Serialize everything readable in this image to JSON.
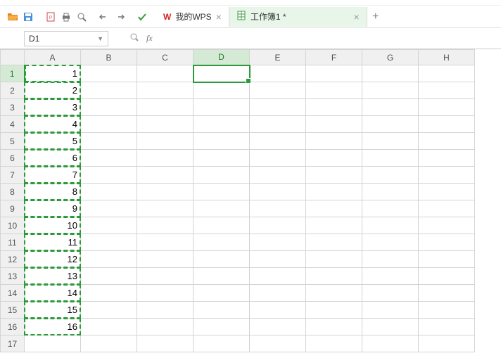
{
  "toolbar": {
    "open_icon": "folder-open-icon",
    "save_icon": "save-icon",
    "export_icon": "export-icon",
    "print_icon": "print-icon",
    "preview_icon": "print-preview-icon",
    "undo_icon": "undo-icon",
    "redo_icon": "redo-icon",
    "check_icon": "check-icon"
  },
  "tabs": [
    {
      "icon": "W",
      "label": "我的WPS",
      "active": false
    },
    {
      "icon": "doc",
      "label": "工作簿1 *",
      "active": true
    }
  ],
  "namebox": {
    "value": "D1"
  },
  "formula": {
    "fx_label": "fx",
    "value": ""
  },
  "columns": [
    "A",
    "B",
    "C",
    "D",
    "E",
    "F",
    "G",
    "H"
  ],
  "rows": [
    1,
    2,
    3,
    4,
    5,
    6,
    7,
    8,
    9,
    10,
    11,
    12,
    13,
    14,
    15,
    16,
    17
  ],
  "selection": {
    "active_col": "D",
    "active_row": 1
  },
  "clipboard_range": {
    "col": "A",
    "row_start": 1,
    "row_end": 16
  },
  "cells": {
    "A1": "1",
    "A2": "2",
    "A3": "3",
    "A4": "4",
    "A5": "5",
    "A6": "6",
    "A7": "7",
    "A8": "8",
    "A9": "9",
    "A10": "10",
    "A11": "11",
    "A12": "12",
    "A13": "13",
    "A14": "14",
    "A15": "15",
    "A16": "16"
  }
}
